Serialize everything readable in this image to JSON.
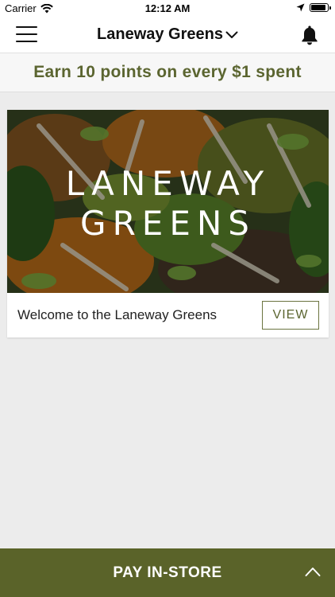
{
  "status_bar": {
    "carrier": "Carrier",
    "time": "12:12 AM",
    "battery_level": 0.9
  },
  "nav": {
    "title": "Laneway Greens",
    "menu_icon": "hamburger-icon",
    "title_icon": "chevron-down-icon",
    "notification_icon": "bell-icon"
  },
  "promo": {
    "text": "Earn 10 points on every $1 spent"
  },
  "card": {
    "brand_line1": "LANEWAY",
    "brand_line2": "GREENS",
    "caption": "Welcome to the Laneway Greens",
    "button_label": "VIEW"
  },
  "pay_bar": {
    "label": "PAY IN-STORE",
    "expand_icon": "chevron-up-icon"
  },
  "colors": {
    "brand_olive": "#5a6329",
    "promo_text": "#5b6530",
    "background": "#ececec"
  }
}
